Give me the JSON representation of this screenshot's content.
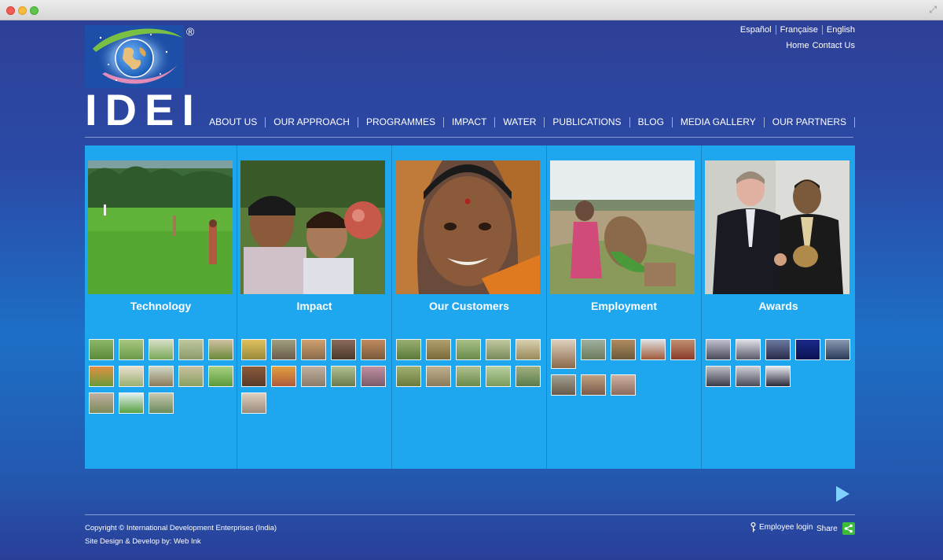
{
  "logo": {
    "text": "IDEI",
    "registered": "®"
  },
  "languages": [
    "Español",
    "Française",
    "English"
  ],
  "top_links": {
    "home": "Home",
    "contact": "Contact Us"
  },
  "nav": [
    "ABOUT US",
    "OUR APPROACH",
    "PROGRAMMES",
    "IMPACT",
    "WATER",
    "PUBLICATIONS",
    "BLOG",
    "MEDIA GALLERY",
    "OUR PARTNERS"
  ],
  "columns": [
    {
      "title": "Technology",
      "thumb_count": 13
    },
    {
      "title": "Impact",
      "thumb_count": 11
    },
    {
      "title": "Our Customers",
      "thumb_count": 10
    },
    {
      "title": "Employment",
      "thumb_count": 8
    },
    {
      "title": "Awards",
      "thumb_count": 8
    }
  ],
  "footer": {
    "copyright": "Copyright © International Development Enterprises (India)",
    "credit": "Site Design & Develop by: Web Ink",
    "employee_login": "Employee login",
    "share": "Share"
  },
  "colors": {
    "panel": "#1ea7ef",
    "share_button": "#3dbb3d",
    "play_arrow": "#7fd2ff"
  }
}
